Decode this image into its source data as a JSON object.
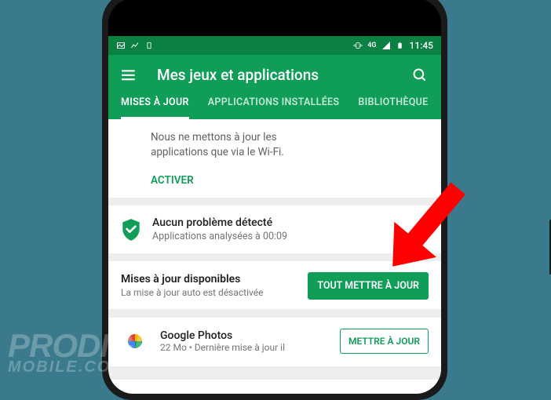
{
  "status": {
    "time": "11:45",
    "network": "4G"
  },
  "header": {
    "title": "Mes jeux et applications"
  },
  "tabs": {
    "updates": "MISES À JOUR",
    "installed": "APPLICATIONS INSTALLÉES",
    "library": "BIBLIOTHÈQUE"
  },
  "info_card": {
    "line1": "Nous ne mettons à jour les",
    "line2": "applications que via le Wi-Fi.",
    "activate": "ACTIVER"
  },
  "protect": {
    "title": "Aucun problème détecté",
    "subtitle": "Applications analysées à 00:09"
  },
  "updates": {
    "title": "Mises à jour disponibles",
    "subtitle": "La mise à jour auto est désactivée",
    "update_all": "TOUT METTRE À JOUR"
  },
  "app": {
    "name": "Google Photos",
    "meta": "22 Mo • Dernière mise à jour il",
    "update_btn": "METTRE À JOUR"
  },
  "watermark": {
    "top": "PRODIGE",
    "bottom": "MOBILE.CO"
  }
}
